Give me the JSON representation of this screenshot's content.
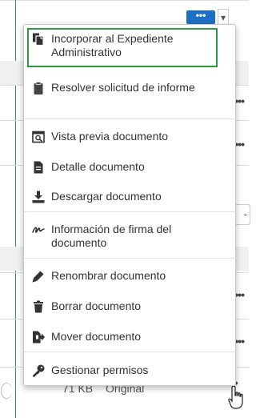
{
  "toolbar": {
    "more_label": "•••"
  },
  "menu": {
    "items": [
      {
        "label": "Incorporar al Expediente Administrativo",
        "icon": "copy-documents-icon"
      },
      {
        "label": "Resolver solicitud de informe",
        "icon": "clipboard-icon"
      },
      {
        "label": "Vista previa documento",
        "icon": "preview-icon"
      },
      {
        "label": "Detalle documento",
        "icon": "document-icon"
      },
      {
        "label": "Descargar documento",
        "icon": "download-icon"
      },
      {
        "label": "Información de firma del documento",
        "icon": "signature-icon"
      },
      {
        "label": "Renombrar documento",
        "icon": "pencil-icon"
      },
      {
        "label": "Borrar documento",
        "icon": "trash-icon"
      },
      {
        "label": "Mover documento",
        "icon": "move-document-icon"
      },
      {
        "label": "Gestionar permisos",
        "icon": "key-icon"
      }
    ]
  },
  "row": {
    "size": "71 KB",
    "type": "Original",
    "actions_label": "•••"
  },
  "colors": {
    "accent_blue": "#1e6fc4",
    "highlight_green": "#2e9a3f"
  }
}
